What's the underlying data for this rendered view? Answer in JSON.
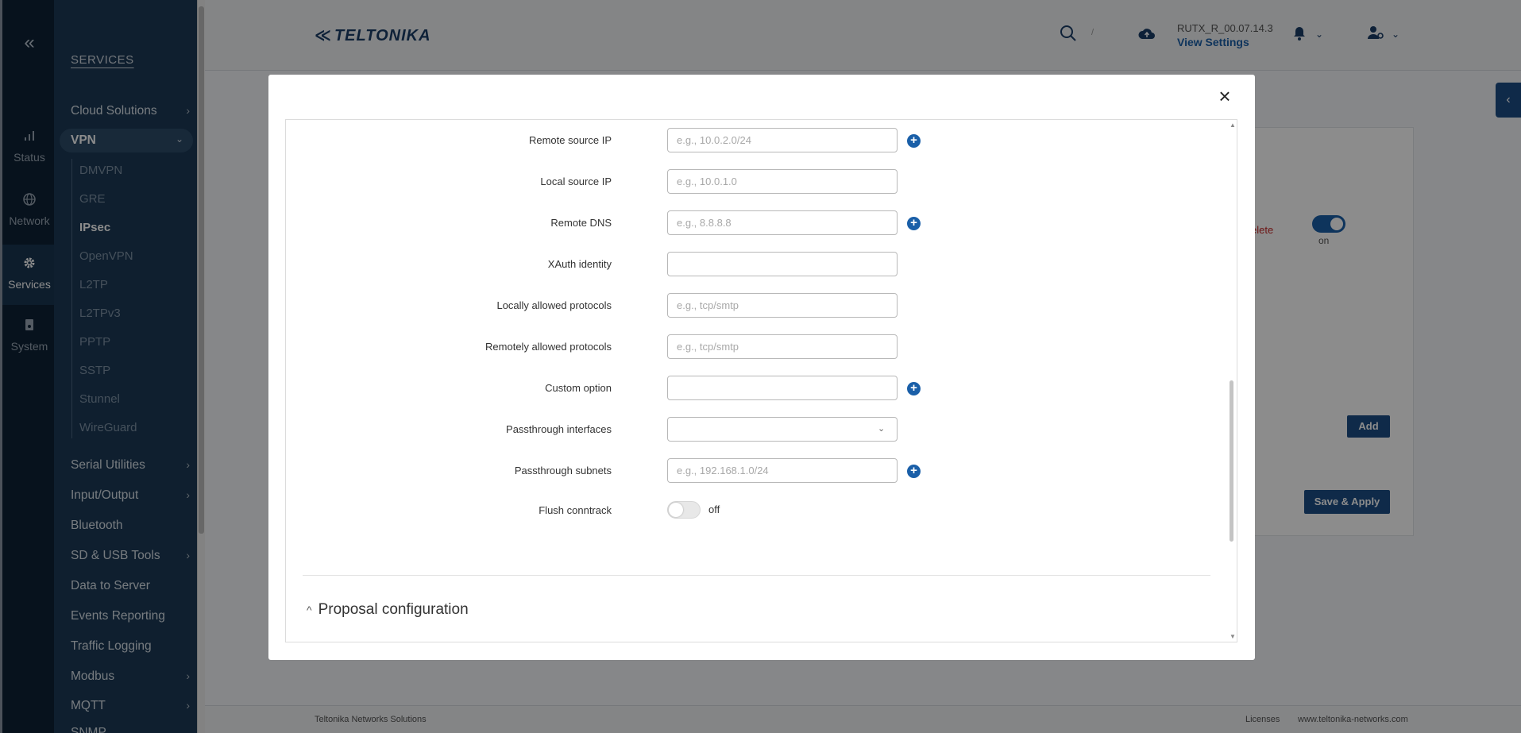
{
  "rail": {
    "collapse_icon": "«",
    "items": [
      {
        "label": "Status",
        "icon": "signal-icon"
      },
      {
        "label": "Network",
        "icon": "globe-icon"
      },
      {
        "label": "Services",
        "icon": "gear-icon"
      },
      {
        "label": "System",
        "icon": "system-icon"
      }
    ]
  },
  "sidebar": {
    "title": "SERVICES",
    "items_top": [
      "Cloud Solutions"
    ],
    "vpn": "VPN",
    "vpn_sub": [
      "DMVPN",
      "GRE",
      "IPsec",
      "OpenVPN",
      "L2TP",
      "L2TPv3",
      "PPTP",
      "SSTP",
      "Stunnel",
      "WireGuard"
    ],
    "items_bottom": [
      {
        "label": "Serial Utilities",
        "chevron": true
      },
      {
        "label": "Input/Output",
        "chevron": true
      },
      {
        "label": "Bluetooth",
        "chevron": false
      },
      {
        "label": "SD & USB Tools",
        "chevron": true
      },
      {
        "label": "Data to Server",
        "chevron": false
      },
      {
        "label": "Events Reporting",
        "chevron": false
      },
      {
        "label": "Traffic Logging",
        "chevron": false
      },
      {
        "label": "Modbus",
        "chevron": true
      },
      {
        "label": "MQTT",
        "chevron": true
      },
      {
        "label": "SNMP",
        "chevron": false
      }
    ]
  },
  "topbar": {
    "brand": "TELTONIKA",
    "search_shortcut": "/",
    "firmware": "RUTX_R_00.07.14.3",
    "view_settings": "View Settings"
  },
  "background": {
    "delete": "elete",
    "toggle_state": "on",
    "add": "Add",
    "save_apply": "Save & Apply"
  },
  "footer": {
    "company": "Teltonika Networks Solutions",
    "licenses": "Licenses",
    "site": "www.teltonika-networks.com"
  },
  "modal": {
    "close_icon": "×",
    "fields": [
      {
        "label": "Remote source IP",
        "placeholder": "e.g., 10.0.2.0/24",
        "value": "",
        "plus": true
      },
      {
        "label": "Local source IP",
        "placeholder": "e.g., 10.0.1.0",
        "value": "",
        "plus": false
      },
      {
        "label": "Remote DNS",
        "placeholder": "e.g., 8.8.8.8",
        "value": "",
        "plus": true
      },
      {
        "label": "XAuth identity",
        "placeholder": "",
        "value": "",
        "plus": false
      },
      {
        "label": "Locally allowed protocols",
        "placeholder": "e.g., tcp/smtp",
        "value": "",
        "plus": false
      },
      {
        "label": "Remotely allowed protocols",
        "placeholder": "e.g., tcp/smtp",
        "value": "",
        "plus": false
      },
      {
        "label": "Custom option",
        "placeholder": "",
        "value": "",
        "plus": true
      }
    ],
    "passthrough_interfaces": {
      "label": "Passthrough interfaces",
      "selected": ""
    },
    "passthrough_subnets": {
      "label": "Passthrough subnets",
      "placeholder": "e.g., 192.168.1.0/24",
      "value": ""
    },
    "flush_conntrack": {
      "label": "Flush conntrack",
      "state": "off"
    },
    "section_title": "Proposal configuration"
  }
}
